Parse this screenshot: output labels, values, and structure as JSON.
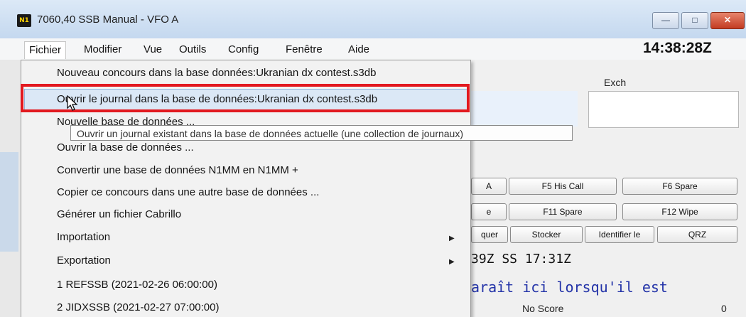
{
  "window": {
    "title": "7060,40 SSB Manual - VFO A",
    "app_icon_text": "N1",
    "clock": "14:38:28Z"
  },
  "menubar": {
    "items": [
      "Fichier",
      "Modifier",
      "Vue",
      "Outils",
      "Config",
      "Fenêtre",
      "Aide"
    ]
  },
  "dropdown": {
    "items": [
      {
        "label": "Nouveau concours dans la base données:Ukranian dx contest.s3db"
      },
      {
        "label": "Ouvrir le journal dans la base de données:Ukranian dx contest.s3db"
      },
      {
        "label": "Nouvelle base de données ..."
      },
      {
        "label": "Ouvrir la base de données ..."
      },
      {
        "label": "Convertir une base de données N1MM en N1MM +"
      },
      {
        "label": "Copier ce concours dans une autre base de données ..."
      },
      {
        "label": "Générer un fichier Cabrillo"
      },
      {
        "label": "Importation",
        "submenu": true
      },
      {
        "label": "Exportation",
        "submenu": true
      },
      {
        "label": "1 REFSSB (2021-02-26 06:00:00)"
      },
      {
        "label": "2 JIDXSSB (2021-02-27 07:00:00)"
      }
    ],
    "tooltip": "Ouvrir un journal existant dans la base de données actuelle (une collection de journaux)"
  },
  "entry": {
    "exch_label": "Exch"
  },
  "function_keys": {
    "row1": [
      "A",
      "F5 His Call",
      "F6 Spare"
    ],
    "row2": [
      "e",
      "F11 Spare",
      "F12 Wipe"
    ],
    "row3": [
      "quer",
      "Stocker",
      "Identifier le",
      "QRZ"
    ]
  },
  "status": {
    "times": "39Z SS 17:31Z",
    "message": "araît ici lorsqu'il est",
    "score": "No Score",
    "count": "0"
  },
  "colors": {
    "highlight_border": "#e2191f",
    "message_blue": "#2333a8"
  }
}
